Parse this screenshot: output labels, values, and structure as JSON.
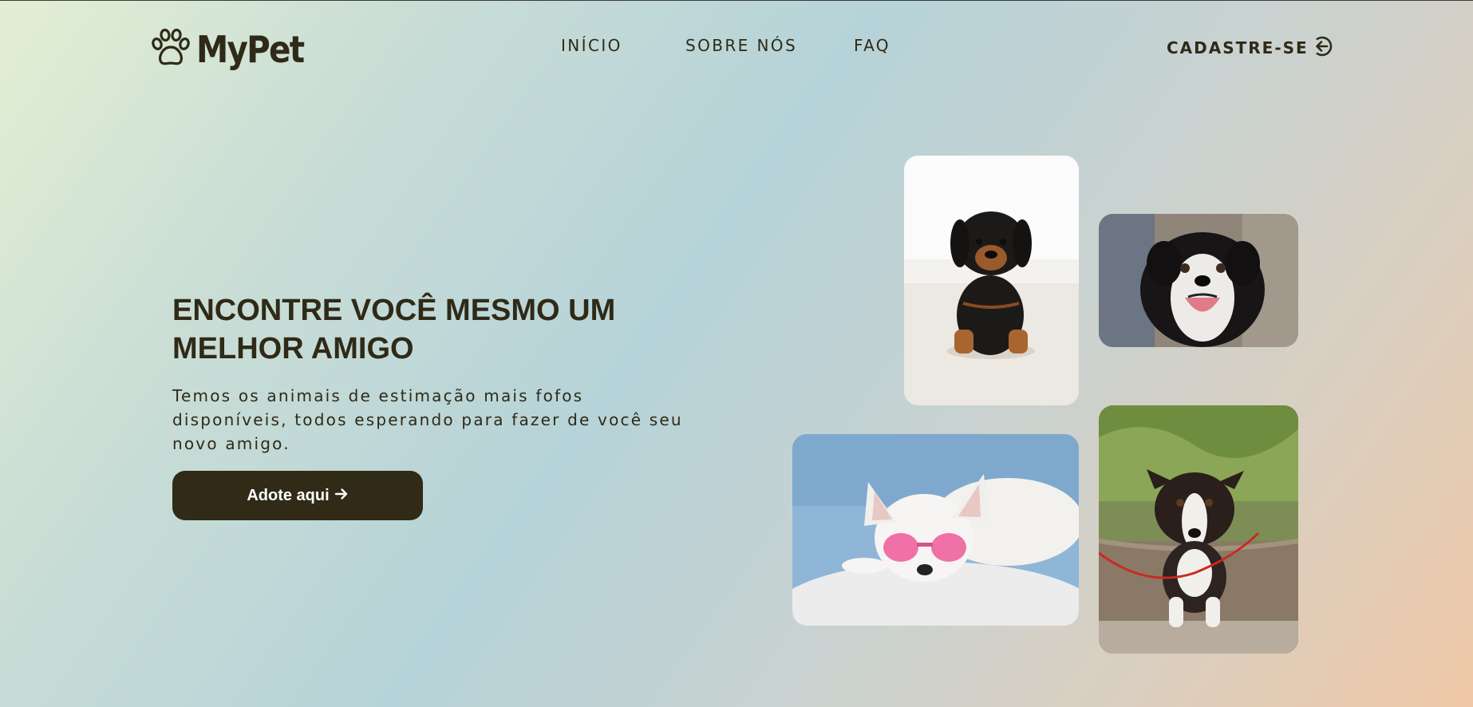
{
  "brand": {
    "name": "MyPet",
    "logo_icon": "paw-icon"
  },
  "nav": {
    "items": [
      {
        "label": "INÍCIO"
      },
      {
        "label": "SOBRE NÓS"
      },
      {
        "label": "FAQ"
      }
    ]
  },
  "signup": {
    "label": "CADASTRE-SE",
    "icon": "sign-in-arrow-icon"
  },
  "hero": {
    "title": "ENCONTRE VOCÊ MESMO UM MELHOR AMIGO",
    "description": "Temos os animais de estimação mais fofos disponíveis, todos esperando para fazer de você seu novo amigo.",
    "cta_label": "Adote aqui",
    "cta_icon": "arrow-right-icon"
  },
  "photos": [
    {
      "subject": "black-and-tan puppy",
      "icon": "dog-photo"
    },
    {
      "subject": "happy border collie",
      "icon": "dog-photo"
    },
    {
      "subject": "white dog with pink heart sunglasses",
      "icon": "dog-photo"
    },
    {
      "subject": "border collie puppy on leash",
      "icon": "dog-photo"
    }
  ],
  "colors": {
    "text": "#2f2a17",
    "button_bg": "#302a16",
    "button_text": "#ffffff",
    "gradient_start": "#e3efd3",
    "gradient_mid": "#b6d3d9",
    "gradient_end": "#efc7a6"
  }
}
